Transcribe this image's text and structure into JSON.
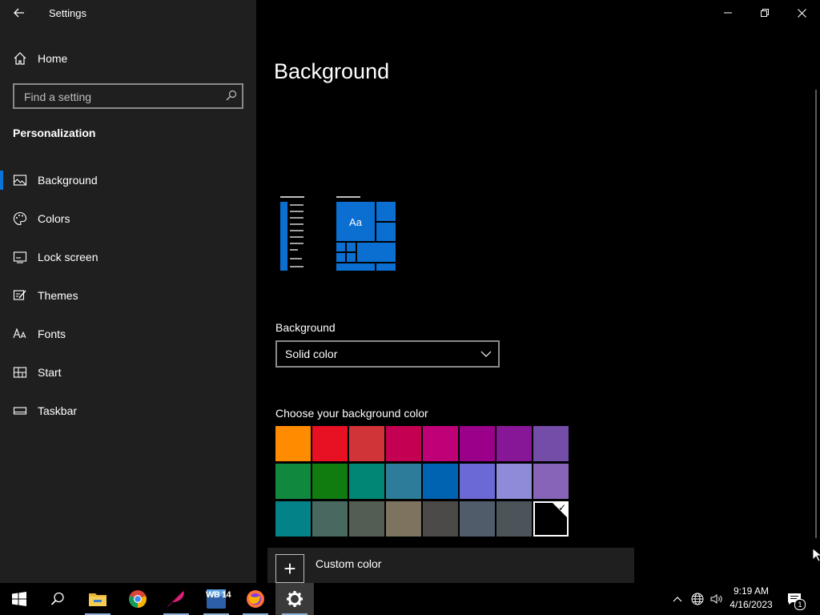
{
  "window": {
    "title": "Settings"
  },
  "sidebar": {
    "home_label": "Home",
    "search_placeholder": "Find a setting",
    "section_title": "Personalization",
    "items": [
      {
        "label": "Background",
        "icon": "picture-icon",
        "active": true
      },
      {
        "label": "Colors",
        "icon": "palette-icon"
      },
      {
        "label": "Lock screen",
        "icon": "lock-screen-icon"
      },
      {
        "label": "Themes",
        "icon": "brush-icon"
      },
      {
        "label": "Fonts",
        "icon": "fonts-icon"
      },
      {
        "label": "Start",
        "icon": "start-icon"
      },
      {
        "label": "Taskbar",
        "icon": "taskbar-icon"
      }
    ]
  },
  "main": {
    "title": "Background",
    "preview_tile_text": "Aa",
    "background_label": "Background",
    "background_value": "Solid color",
    "choose_color_label": "Choose your background color",
    "swatch_colors": [
      [
        "#ff8c00",
        "#e81123",
        "#d13438",
        "#c30052",
        "#bf0077",
        "#9a0089",
        "#881798",
        "#744da9"
      ],
      [
        "#10893e",
        "#107c10",
        "#018574",
        "#2d7d9a",
        "#0063b1",
        "#6b69d6",
        "#8e8cd8",
        "#8764b8"
      ],
      [
        "#038387",
        "#486860",
        "#525e54",
        "#7e735f",
        "#4c4a48",
        "#515c6b",
        "#4a5459",
        "#000000"
      ]
    ],
    "selected_swatch": "#000000",
    "custom_color_label": "Custom color"
  },
  "taskbar": {
    "apps": [
      "start-icon",
      "search-icon",
      "file-explorer-icon",
      "chrome-icon",
      "feather-app-icon",
      "wb14-app-icon",
      "firefox-icon",
      "settings-gear-icon"
    ],
    "wb_label": "WB 14",
    "time": "9:19 AM",
    "date": "4/16/2023",
    "notification_count": "1"
  },
  "colors": {
    "accent": "#0078d7",
    "sidebar_bg": "#1f1f1f",
    "main_bg": "#000000"
  }
}
